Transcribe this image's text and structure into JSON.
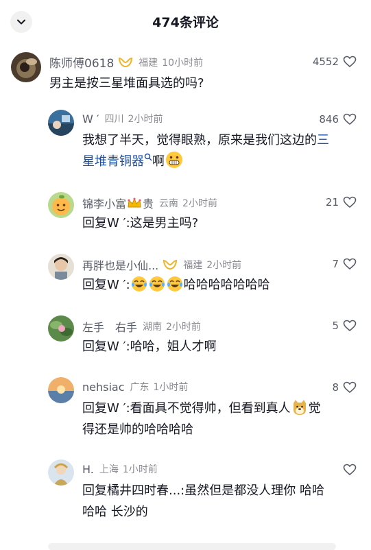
{
  "header": {
    "title": "474条评论"
  },
  "comments": [
    {
      "username": "陈师傅0618",
      "location": "福建",
      "time": "10小时前",
      "likes": "4552",
      "text": "男主是按三星堆面具选的吗?"
    }
  ],
  "replies": [
    {
      "username": "W ′",
      "location": "四川",
      "time": "2小时前",
      "likes": "846",
      "text_pre": "我想了半天，觉得眼熟，原来是我们这边的",
      "link_1": "三",
      "link_2": "星堆青铜器",
      "text_post": "啊"
    },
    {
      "username": "锦李小富",
      "username_suffix": "贵",
      "location": "云南",
      "time": "2小时前",
      "likes": "21",
      "text": "回复W ′:这是男主吗?"
    },
    {
      "username": "再胖也是小仙...",
      "location": "福建",
      "time": "2小时前",
      "likes": "7",
      "text_pre": "回复W ′:",
      "text_post": "哈哈哈哈哈哈哈"
    },
    {
      "username": "左手　右手",
      "location": "湖南",
      "time": "2小时前",
      "likes": "5",
      "text": "回复W ′:哈哈，姐人才啊"
    },
    {
      "username": "nehsiac",
      "location": "广东",
      "time": "1小时前",
      "likes": "8",
      "text_line1_pre": "回复W ′:看面具不觉得帅，但看到真人",
      "text_line1_post": "觉",
      "text_line2": "得还是帅的哈哈哈哈"
    },
    {
      "username": "H.",
      "location": "上海",
      "time": "1小时前",
      "likes": "",
      "text_line1": "回复橘井四时春...:虽然但是都没人理你 哈哈",
      "text_line2": "哈哈 长沙的"
    }
  ]
}
